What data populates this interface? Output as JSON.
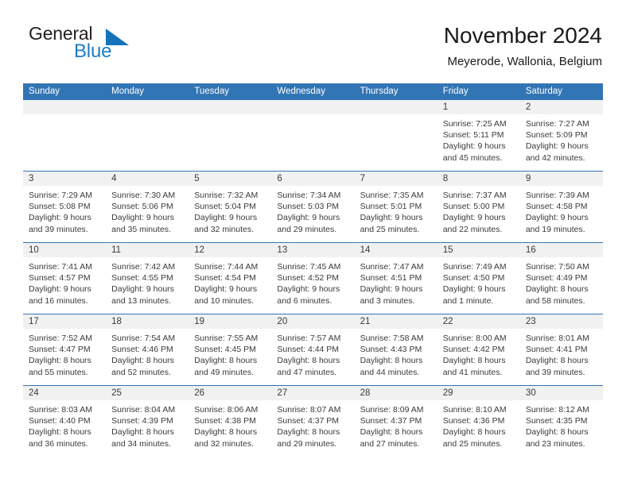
{
  "brand": {
    "name_part1": "General",
    "name_part2": "Blue",
    "triangle_color": "#1573bb",
    "blue_color": "#1c7cc4"
  },
  "header": {
    "title": "November 2024",
    "subtitle": "Meyerode, Wallonia, Belgium",
    "accent_color": "#3275b5"
  },
  "weekdays": [
    "Sunday",
    "Monday",
    "Tuesday",
    "Wednesday",
    "Thursday",
    "Friday",
    "Saturday"
  ],
  "weeks": [
    [
      {
        "day": "",
        "empty": true
      },
      {
        "day": "",
        "empty": true
      },
      {
        "day": "",
        "empty": true
      },
      {
        "day": "",
        "empty": true
      },
      {
        "day": "",
        "empty": true
      },
      {
        "day": "1",
        "sunrise": "Sunrise: 7:25 AM",
        "sunset": "Sunset: 5:11 PM",
        "daylight1": "Daylight: 9 hours",
        "daylight2": "and 45 minutes."
      },
      {
        "day": "2",
        "sunrise": "Sunrise: 7:27 AM",
        "sunset": "Sunset: 5:09 PM",
        "daylight1": "Daylight: 9 hours",
        "daylight2": "and 42 minutes."
      }
    ],
    [
      {
        "day": "3",
        "sunrise": "Sunrise: 7:29 AM",
        "sunset": "Sunset: 5:08 PM",
        "daylight1": "Daylight: 9 hours",
        "daylight2": "and 39 minutes."
      },
      {
        "day": "4",
        "sunrise": "Sunrise: 7:30 AM",
        "sunset": "Sunset: 5:06 PM",
        "daylight1": "Daylight: 9 hours",
        "daylight2": "and 35 minutes."
      },
      {
        "day": "5",
        "sunrise": "Sunrise: 7:32 AM",
        "sunset": "Sunset: 5:04 PM",
        "daylight1": "Daylight: 9 hours",
        "daylight2": "and 32 minutes."
      },
      {
        "day": "6",
        "sunrise": "Sunrise: 7:34 AM",
        "sunset": "Sunset: 5:03 PM",
        "daylight1": "Daylight: 9 hours",
        "daylight2": "and 29 minutes."
      },
      {
        "day": "7",
        "sunrise": "Sunrise: 7:35 AM",
        "sunset": "Sunset: 5:01 PM",
        "daylight1": "Daylight: 9 hours",
        "daylight2": "and 25 minutes."
      },
      {
        "day": "8",
        "sunrise": "Sunrise: 7:37 AM",
        "sunset": "Sunset: 5:00 PM",
        "daylight1": "Daylight: 9 hours",
        "daylight2": "and 22 minutes."
      },
      {
        "day": "9",
        "sunrise": "Sunrise: 7:39 AM",
        "sunset": "Sunset: 4:58 PM",
        "daylight1": "Daylight: 9 hours",
        "daylight2": "and 19 minutes."
      }
    ],
    [
      {
        "day": "10",
        "sunrise": "Sunrise: 7:41 AM",
        "sunset": "Sunset: 4:57 PM",
        "daylight1": "Daylight: 9 hours",
        "daylight2": "and 16 minutes."
      },
      {
        "day": "11",
        "sunrise": "Sunrise: 7:42 AM",
        "sunset": "Sunset: 4:55 PM",
        "daylight1": "Daylight: 9 hours",
        "daylight2": "and 13 minutes."
      },
      {
        "day": "12",
        "sunrise": "Sunrise: 7:44 AM",
        "sunset": "Sunset: 4:54 PM",
        "daylight1": "Daylight: 9 hours",
        "daylight2": "and 10 minutes."
      },
      {
        "day": "13",
        "sunrise": "Sunrise: 7:45 AM",
        "sunset": "Sunset: 4:52 PM",
        "daylight1": "Daylight: 9 hours",
        "daylight2": "and 6 minutes."
      },
      {
        "day": "14",
        "sunrise": "Sunrise: 7:47 AM",
        "sunset": "Sunset: 4:51 PM",
        "daylight1": "Daylight: 9 hours",
        "daylight2": "and 3 minutes."
      },
      {
        "day": "15",
        "sunrise": "Sunrise: 7:49 AM",
        "sunset": "Sunset: 4:50 PM",
        "daylight1": "Daylight: 9 hours",
        "daylight2": "and 1 minute."
      },
      {
        "day": "16",
        "sunrise": "Sunrise: 7:50 AM",
        "sunset": "Sunset: 4:49 PM",
        "daylight1": "Daylight: 8 hours",
        "daylight2": "and 58 minutes."
      }
    ],
    [
      {
        "day": "17",
        "sunrise": "Sunrise: 7:52 AM",
        "sunset": "Sunset: 4:47 PM",
        "daylight1": "Daylight: 8 hours",
        "daylight2": "and 55 minutes."
      },
      {
        "day": "18",
        "sunrise": "Sunrise: 7:54 AM",
        "sunset": "Sunset: 4:46 PM",
        "daylight1": "Daylight: 8 hours",
        "daylight2": "and 52 minutes."
      },
      {
        "day": "19",
        "sunrise": "Sunrise: 7:55 AM",
        "sunset": "Sunset: 4:45 PM",
        "daylight1": "Daylight: 8 hours",
        "daylight2": "and 49 minutes."
      },
      {
        "day": "20",
        "sunrise": "Sunrise: 7:57 AM",
        "sunset": "Sunset: 4:44 PM",
        "daylight1": "Daylight: 8 hours",
        "daylight2": "and 47 minutes."
      },
      {
        "day": "21",
        "sunrise": "Sunrise: 7:58 AM",
        "sunset": "Sunset: 4:43 PM",
        "daylight1": "Daylight: 8 hours",
        "daylight2": "and 44 minutes."
      },
      {
        "day": "22",
        "sunrise": "Sunrise: 8:00 AM",
        "sunset": "Sunset: 4:42 PM",
        "daylight1": "Daylight: 8 hours",
        "daylight2": "and 41 minutes."
      },
      {
        "day": "23",
        "sunrise": "Sunrise: 8:01 AM",
        "sunset": "Sunset: 4:41 PM",
        "daylight1": "Daylight: 8 hours",
        "daylight2": "and 39 minutes."
      }
    ],
    [
      {
        "day": "24",
        "sunrise": "Sunrise: 8:03 AM",
        "sunset": "Sunset: 4:40 PM",
        "daylight1": "Daylight: 8 hours",
        "daylight2": "and 36 minutes."
      },
      {
        "day": "25",
        "sunrise": "Sunrise: 8:04 AM",
        "sunset": "Sunset: 4:39 PM",
        "daylight1": "Daylight: 8 hours",
        "daylight2": "and 34 minutes."
      },
      {
        "day": "26",
        "sunrise": "Sunrise: 8:06 AM",
        "sunset": "Sunset: 4:38 PM",
        "daylight1": "Daylight: 8 hours",
        "daylight2": "and 32 minutes."
      },
      {
        "day": "27",
        "sunrise": "Sunrise: 8:07 AM",
        "sunset": "Sunset: 4:37 PM",
        "daylight1": "Daylight: 8 hours",
        "daylight2": "and 29 minutes."
      },
      {
        "day": "28",
        "sunrise": "Sunrise: 8:09 AM",
        "sunset": "Sunset: 4:37 PM",
        "daylight1": "Daylight: 8 hours",
        "daylight2": "and 27 minutes."
      },
      {
        "day": "29",
        "sunrise": "Sunrise: 8:10 AM",
        "sunset": "Sunset: 4:36 PM",
        "daylight1": "Daylight: 8 hours",
        "daylight2": "and 25 minutes."
      },
      {
        "day": "30",
        "sunrise": "Sunrise: 8:12 AM",
        "sunset": "Sunset: 4:35 PM",
        "daylight1": "Daylight: 8 hours",
        "daylight2": "and 23 minutes."
      }
    ]
  ]
}
